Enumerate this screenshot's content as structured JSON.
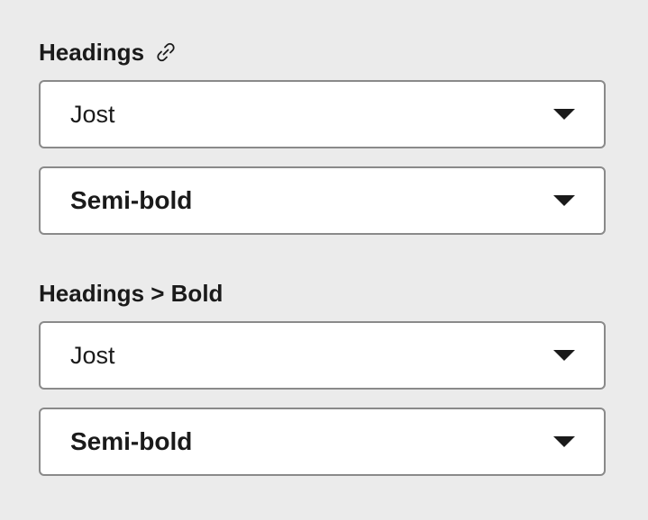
{
  "groups": [
    {
      "label": "Headings",
      "label_icon": "link-icon",
      "family": {
        "value": "Jost"
      },
      "weight": {
        "value": "Semi-bold"
      }
    },
    {
      "label": "Headings > Bold",
      "family": {
        "value": "Jost"
      },
      "weight": {
        "value": "Semi-bold"
      }
    }
  ],
  "colors": {
    "background": "#ebebeb",
    "field_background": "#ffffff",
    "field_border": "#8a8a8a",
    "text": "#1a1a1a"
  }
}
